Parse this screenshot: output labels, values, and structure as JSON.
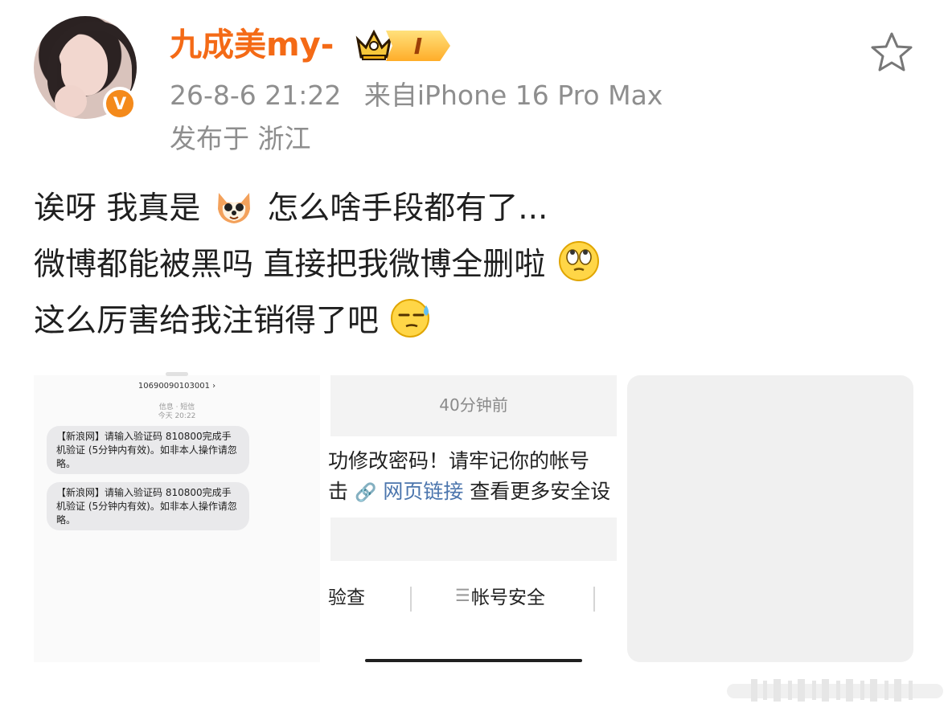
{
  "header": {
    "username": "九成美my-",
    "level": "I",
    "timestamp": "26-8-6 21:22",
    "source": "来自iPhone 16 Pro Max",
    "location": "发布于 浙江",
    "verified": "V"
  },
  "post": {
    "line1_a": "诶呀 我真是",
    "line1_b": "怎么啥手段都有了...",
    "line2": "微博都能被黑吗 直接把我微博全删啦",
    "line3": "这么厉害给我注销得了吧"
  },
  "sms": {
    "number": "10690090103001 ›",
    "type": "信息 · 短信",
    "date": "今天 20:22",
    "messages": [
      "【新浪网】请输入验证码 810800完成手机验证 (5分钟内有效)。如非本人操作请忽略。",
      "【新浪网】请输入验证码 810800完成手机验证 (5分钟内有效)。如非本人操作请忽略。"
    ]
  },
  "security_card": {
    "time": "40分钟前",
    "line1": "功修改密码！请牢记你的帐号",
    "line2_prefix": "击",
    "link": "网页链接",
    "line2_suffix": "查看更多安全设",
    "tab_left": "验查",
    "account_safe": "帐号安全"
  },
  "icons": {
    "favorite": "star-outline-icon",
    "crown": "crown-icon",
    "link": "link-icon",
    "menu": "menu-icon"
  },
  "colors": {
    "username": "#f46a16",
    "meta": "#8e8e8e",
    "verified": "#f48a1b",
    "link": "#4b75ad"
  }
}
